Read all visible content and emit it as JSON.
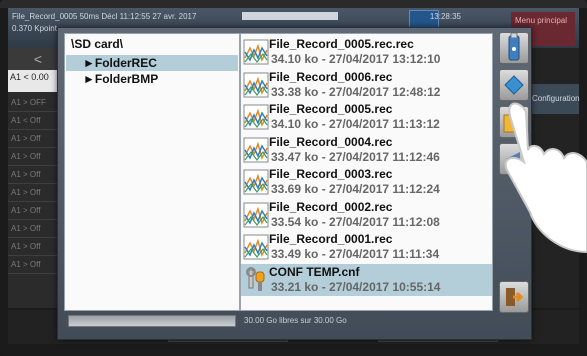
{
  "status_bar": {
    "line1": "File_Record_0005 50ms Décl 11:12:55 27 avr. 2017",
    "line2": "0.370 Kpoint",
    "time": "13:28:35",
    "right_button": "Menu principal"
  },
  "left_column": {
    "back_glyph": "<",
    "channel_label": "A1 < 0.00",
    "rows": [
      "A1 > OFF",
      "A1 < Off",
      "A1 > Off",
      "A1 > Off",
      "A1 > Off",
      "A1 > Off",
      "A1 > Off",
      "A1 > Off",
      "A1 > Off",
      "A1 > Off"
    ]
  },
  "right_column": {
    "highlight": "Configuration"
  },
  "dialog": {
    "tree": {
      "root": "\\SD card\\",
      "nodes": [
        {
          "label": "FolderREC",
          "selected": true
        },
        {
          "label": "FolderBMP",
          "selected": false
        }
      ],
      "node_prefix": "►"
    },
    "files": [
      {
        "name": "File_Record_0005.rec.rec",
        "meta": "34.10 ko - 27/04/2017 13:12:10",
        "type": "rec",
        "selected": false
      },
      {
        "name": "File_Record_0006.rec",
        "meta": "33.38 ko - 27/04/2017 12:48:12",
        "type": "rec",
        "selected": false
      },
      {
        "name": "File_Record_0005.rec",
        "meta": "34.10 ko - 27/04/2017 11:13:12",
        "type": "rec",
        "selected": false
      },
      {
        "name": "File_Record_0004.rec",
        "meta": "33.47 ko - 27/04/2017 11:12:46",
        "type": "rec",
        "selected": false
      },
      {
        "name": "File_Record_0003.rec",
        "meta": "33.69 ko - 27/04/2017 11:12:24",
        "type": "rec",
        "selected": false
      },
      {
        "name": "File_Record_0002.rec",
        "meta": "33.54 ko - 27/04/2017 11:12:08",
        "type": "rec",
        "selected": false
      },
      {
        "name": "File_Record_0001.rec",
        "meta": "33.49 ko - 27/04/2017 11:11:34",
        "type": "rec",
        "selected": false
      },
      {
        "name": "CONF TEMP.cnf",
        "meta": "33.21 ko - 27/04/2017 10:55:14",
        "type": "cnf",
        "selected": true
      }
    ],
    "side_buttons": [
      "usb-icon",
      "copy-icon",
      "folder-icon",
      "arrow-icon",
      "exit-icon"
    ],
    "storage_fill": 1.0,
    "free_space_text": "30.00 Go libres sur 30.00 Go"
  },
  "colors": {
    "selection": "#b4ced9",
    "dialog_bg": "#5f6a76",
    "list_bg": "#fafafa"
  }
}
